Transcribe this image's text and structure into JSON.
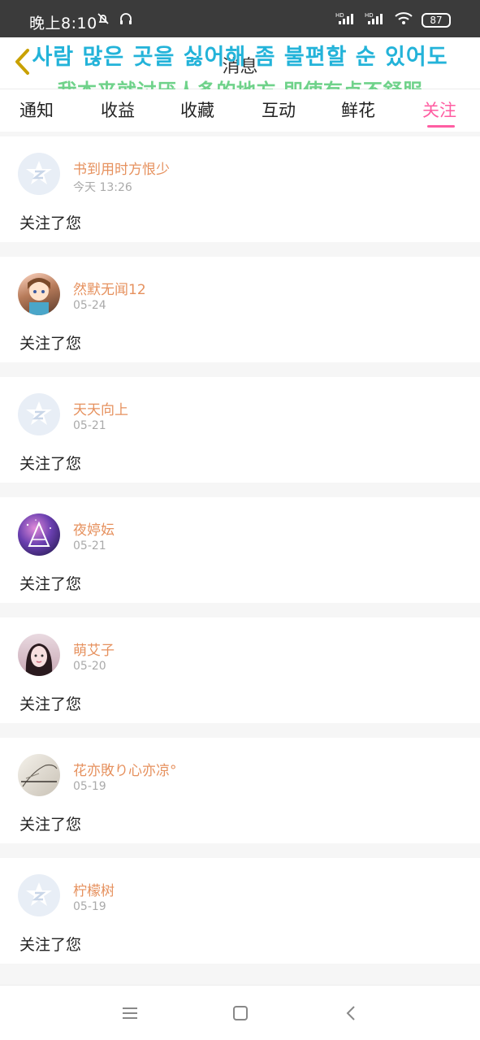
{
  "status_bar": {
    "time": "晚上8:10",
    "battery": "87",
    "icons": [
      "do-not-disturb-icon",
      "headset-icon",
      "hd-signal-icon",
      "hd-signal-icon",
      "wifi-icon",
      "battery-icon"
    ]
  },
  "header": {
    "title": "消息",
    "back_icon": "chevron-left-icon"
  },
  "overlay_text": {
    "korean": "사람 많은 곳을 싫어해 좀 불편할 순 있어도",
    "chinese": "我本来就讨厌人多的地方 即使有点不舒服"
  },
  "tabs": [
    {
      "label": "通知"
    },
    {
      "label": "收益"
    },
    {
      "label": "收藏"
    },
    {
      "label": "互动"
    },
    {
      "label": "鲜花"
    },
    {
      "label": "关注"
    }
  ],
  "colors": {
    "accent": "#ff5da2",
    "name": "#e6915e"
  },
  "items": [
    {
      "name": "书到用时方恨少",
      "time": "今天 13:26",
      "message": "关注了您",
      "avatar": "qq-default-avatar"
    },
    {
      "name": "然默无闻12",
      "time": "05-24",
      "message": "关注了您",
      "avatar": "anime-girl-avatar"
    },
    {
      "name": "天天向上",
      "time": "05-21",
      "message": "关注了您",
      "avatar": "qq-default-avatar"
    },
    {
      "name": "夜婷妘",
      "time": "05-21",
      "message": "关注了您",
      "avatar": "galaxy-avatar"
    },
    {
      "name": "萌艾子",
      "time": "05-20",
      "message": "关注了您",
      "avatar": "portrait-avatar"
    },
    {
      "name": "花亦敗り心亦凉°",
      "time": "05-19",
      "message": "关注了您",
      "avatar": "sketch-avatar"
    },
    {
      "name": "柠檬树",
      "time": "05-19",
      "message": "关注了您",
      "avatar": "qq-default-avatar"
    }
  ],
  "navigation_bar": {
    "icons": [
      "menu-icon",
      "home-square-icon",
      "back-arrow-icon"
    ]
  }
}
